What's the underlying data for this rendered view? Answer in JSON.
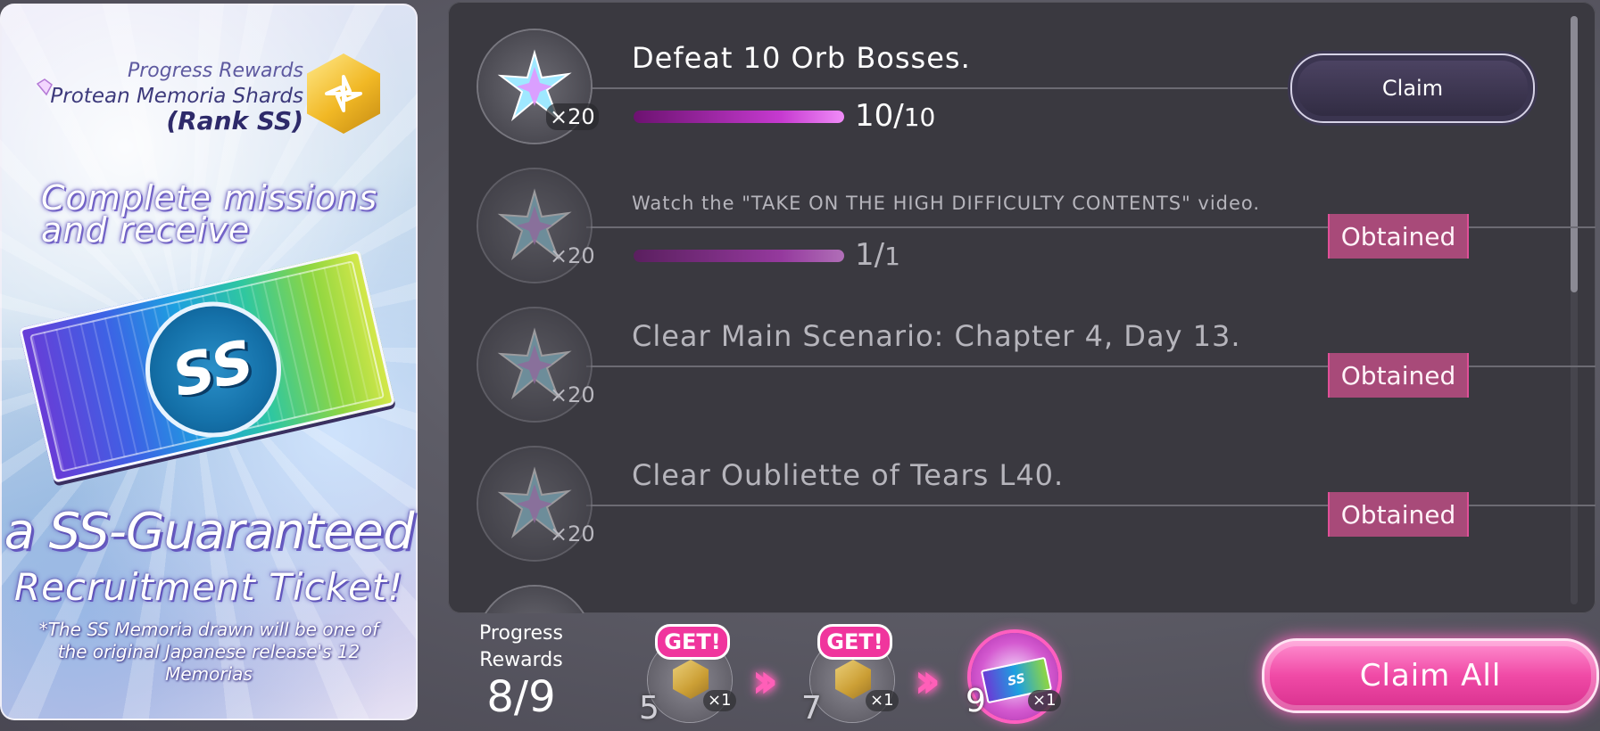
{
  "banner": {
    "line1": "Progress Rewards",
    "line2": "Protean Memoria Shards",
    "line3": "(Rank SS)",
    "headline1": "Complete missions",
    "headline2": "and receive",
    "ticket_text": "SS",
    "guaranteed1": "a SS-Guaranteed",
    "guaranteed2": "Recruitment Ticket!",
    "disclaimer": "*The SS Memoria drawn will be one of the original Japanese release's 12 Memorias"
  },
  "missions": [
    {
      "title": "Defeat 10 Orb Bosses.",
      "reward_qty": "×20",
      "progress_num": "10",
      "progress_den": "10",
      "progress_fraction": 1.0,
      "status": "Claim"
    },
    {
      "title": "Watch the \"TAKE ON THE HIGH DIFFICULTY CONTENTS\" video.",
      "reward_qty": "×20",
      "progress_num": "1",
      "progress_den": "1",
      "progress_fraction": 1.0,
      "status": "Obtained"
    },
    {
      "title": "Clear Main Scenario: Chapter 4, Day 13.",
      "reward_qty": "×20",
      "status": "Obtained"
    },
    {
      "title": "Clear Oubliette of Tears L40.",
      "reward_qty": "×20",
      "status": "Obtained"
    }
  ],
  "footer": {
    "progress_label": "Progress Rewards",
    "progress_value": "8/9",
    "milestones": [
      {
        "number": "5",
        "qty": "×1",
        "tag": "GET!"
      },
      {
        "number": "7",
        "qty": "×1",
        "tag": "GET!"
      },
      {
        "number": "9",
        "qty": "×1",
        "ticket_text": "SS"
      }
    ],
    "claim_all": "Claim All"
  }
}
